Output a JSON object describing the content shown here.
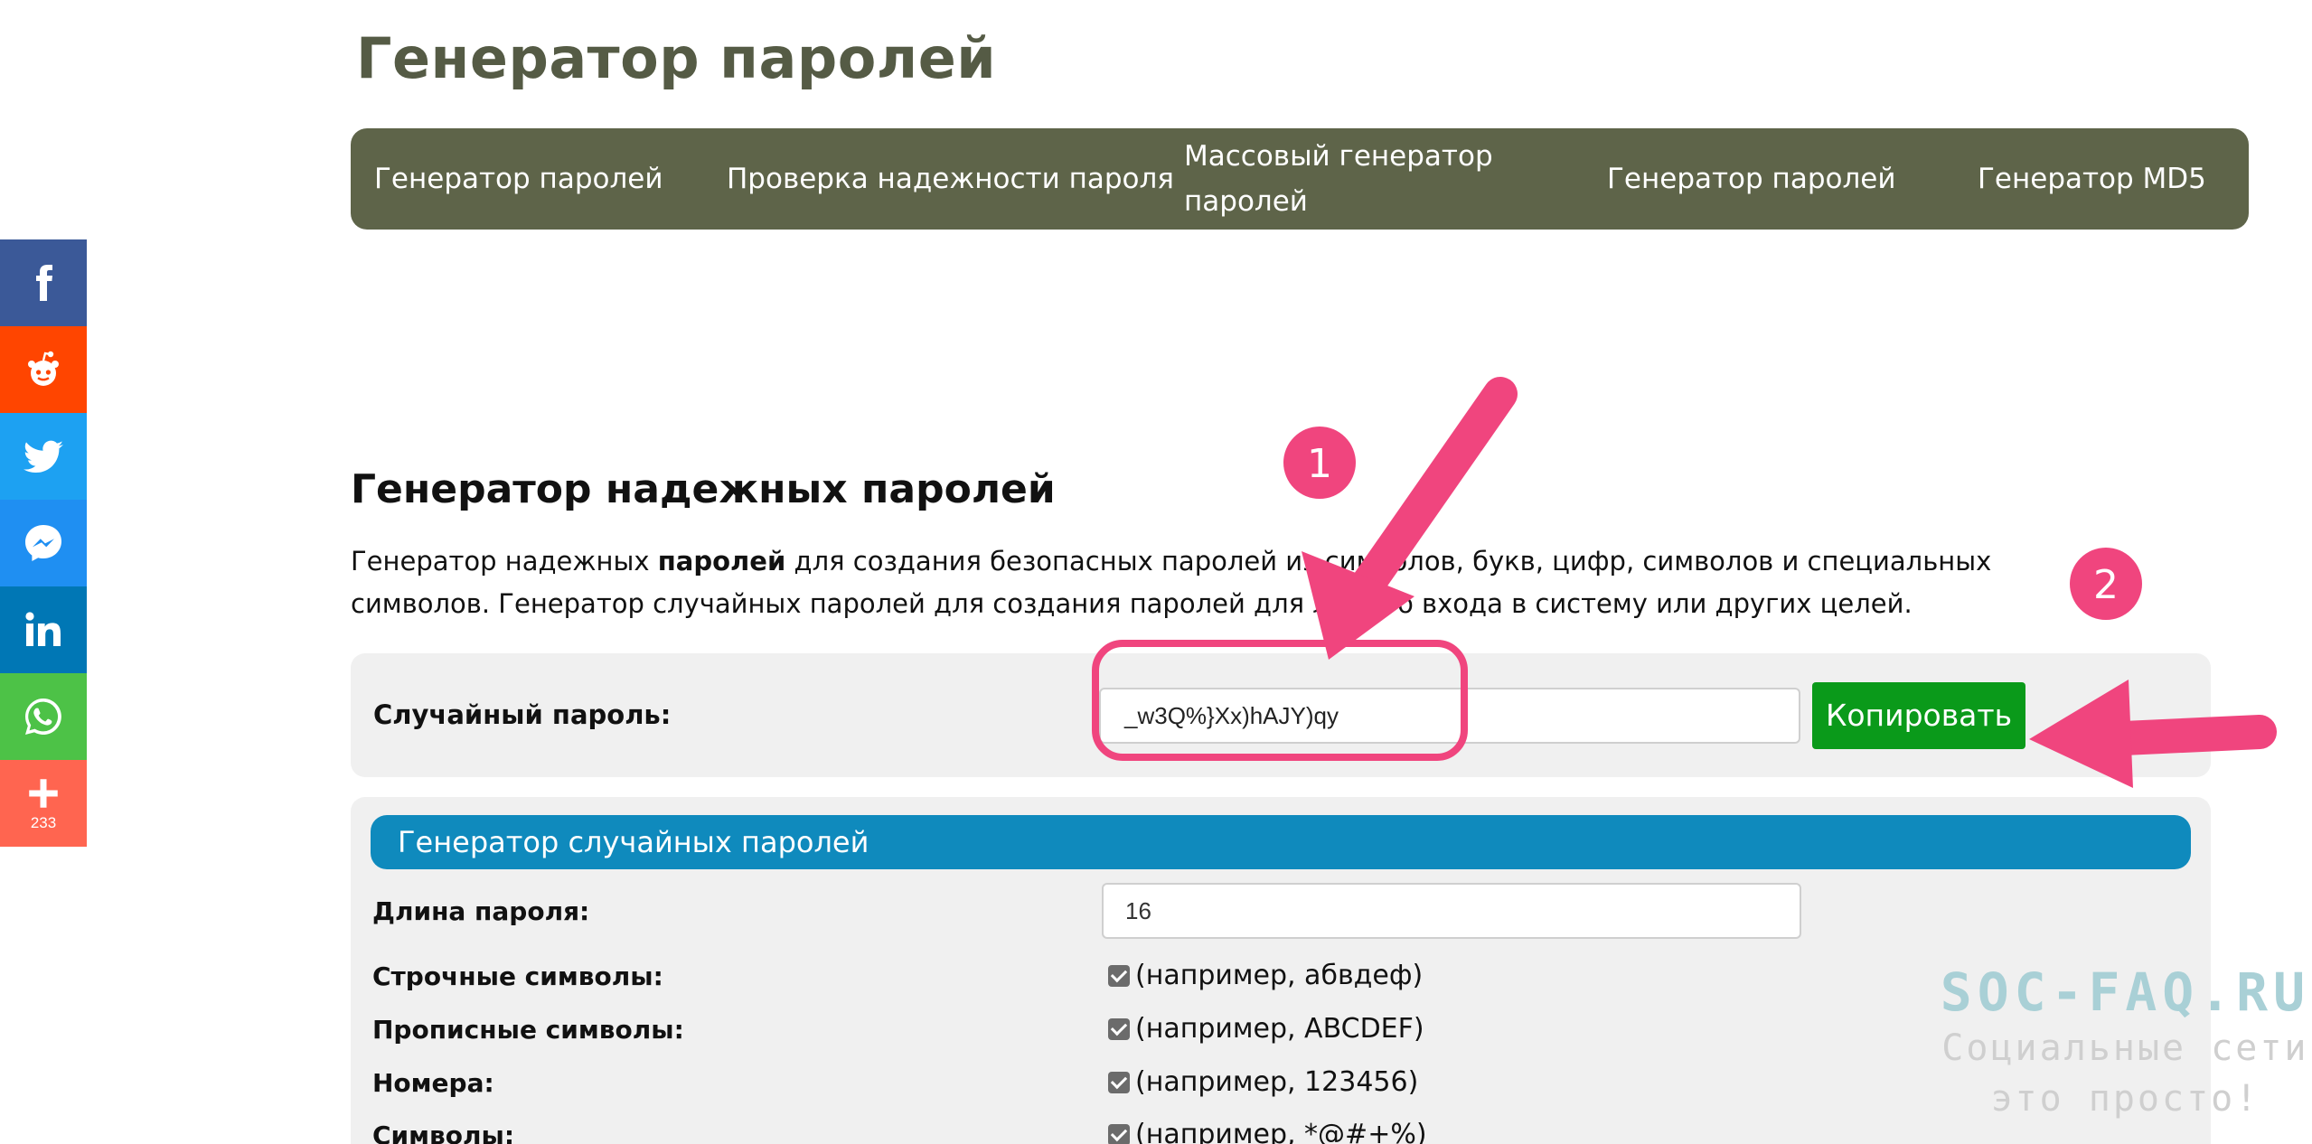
{
  "page_title": "Генератор паролей",
  "nav": [
    {
      "label": "Генератор паролей"
    },
    {
      "label": "Проверка надежности пароля"
    },
    {
      "label_line1": "Массовый генератор",
      "label_line2": "паролей"
    },
    {
      "label": "Генератор паролей"
    },
    {
      "label": "Генератор MD5"
    }
  ],
  "social": {
    "share_count": "233",
    "buttons": [
      {
        "icon": "facebook-icon",
        "color": "#3b5998"
      },
      {
        "icon": "reddit-icon",
        "color": "#ff4500"
      },
      {
        "icon": "twitter-icon",
        "color": "#1da1f2"
      },
      {
        "icon": "messenger-icon",
        "color": "#1f8ff2"
      },
      {
        "icon": "linkedin-icon",
        "color": "#0077b5"
      },
      {
        "icon": "whatsapp-icon",
        "color": "#4dc247"
      },
      {
        "icon": "plus-icon",
        "color": "#ff6550"
      }
    ]
  },
  "section": {
    "title": "Генератор надежных паролей",
    "desc_part1": "Генератор надежных ",
    "desc_bold": "паролей",
    "desc_part2": " для создания безопасных паролей из символов, букв, цифр, символов и специальных символов. Генератор случайных паролей для создания паролей для любого входа в систему или других целей."
  },
  "password": {
    "label": "Случайный пароль:",
    "value": "_w3Q%}Xx)hAJY)qy",
    "copy_label": "Копировать"
  },
  "options": {
    "header": "Генератор случайных паролей",
    "length_label": "Длина пароля:",
    "length_value": "16",
    "rows": [
      {
        "label": "Строчные символы:",
        "text": "(например, абвдеф)",
        "checked": true
      },
      {
        "label": "Прописные символы:",
        "text": "(например, ABCDEF)",
        "checked": true
      },
      {
        "label": "Номера:",
        "text": "(например, 123456)",
        "checked": true
      },
      {
        "label": "Символы:",
        "text": "(например, *@#+%)",
        "checked": true
      }
    ]
  },
  "annotations": {
    "badge1": "1",
    "badge2": "2",
    "accent_color": "#f0457e"
  },
  "watermark": {
    "title": "SOC-FAQ.RU",
    "line1": "Социальные сети",
    "line2": "это просто!"
  }
}
